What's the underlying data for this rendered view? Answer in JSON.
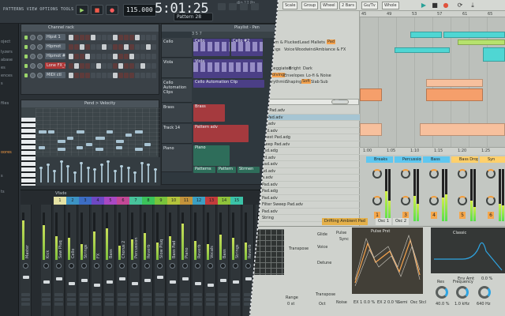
{
  "fl": {
    "title": "dio 12 Po",
    "menu": "PATTERNS VIEW OPTIONS TOOLS ?",
    "tempo": "115.000",
    "time": "5:01:25",
    "pattern": "Pattern 28",
    "channel_rack_title": "Channel rack",
    "channels": [
      {
        "name": "Hipst 1",
        "red": false
      },
      {
        "name": "Hipmot",
        "red": false
      },
      {
        "name": "Hipmot #2",
        "red": false
      },
      {
        "name": "Lone FX_sinog",
        "red": true
      },
      {
        "name": "MIDI ctl",
        "red": false
      }
    ],
    "browser_items": [
      {
        "label": "oject",
        "hi": false
      },
      {
        "label": "lyzers",
        "hi": false
      },
      {
        "label": "abase",
        "hi": false
      },
      {
        "label": "es",
        "hi": false
      },
      {
        "label": "ences",
        "hi": false
      },
      {
        "label": "s",
        "hi": false
      },
      {
        "label": "files",
        "hi": false
      },
      {
        "label": "oores",
        "hi": true
      },
      {
        "label": "s",
        "hi": false
      },
      {
        "label": "ts",
        "hi": false
      }
    ],
    "pianoroll_title": "Pend > Velocity",
    "playlist_title": "Playlist - Pen",
    "playlist_tracks": [
      "Cello",
      "Viola",
      "Cello Automation Clips",
      "Brass",
      "Track 14",
      "Piano"
    ],
    "clip_labels": {
      "cello": "Cello",
      "cello2": "Cello #2",
      "viola": "Viola",
      "automation": "Cello Automation Clip",
      "brass": "Brass",
      "pattern": "Pattern adv",
      "piano": "Piano",
      "pattern2": "Patterns",
      "pattern3": "Pattern",
      "strm": "Strmen"
    },
    "ruler_numbers": [
      "3",
      "5",
      "7"
    ],
    "mixer_strips": [
      "Master",
      "Kick",
      "Saw Pluq",
      "Cello",
      "Strings",
      "FX",
      "Bass",
      "Chorus 2",
      "Percussion",
      "Reverb",
      "Slow Pluq",
      "Bass Pad",
      "Piano",
      "Reverb",
      "Vocals",
      "Bass",
      "Strings",
      "Reverb",
      "Bass",
      "Pad"
    ],
    "mixer_colors": [
      "#e5e2a4",
      "#3c93c4",
      "#3c6dc4",
      "#6e48c3",
      "#a948c3",
      "#c34896",
      "#48c39b",
      "#3bc35a",
      "#79c33b",
      "#b4c33b",
      "#c3933b",
      "#3b9fc3",
      "#c33b3b",
      "#8fc33b",
      "#3bc3a8"
    ],
    "mixer_numbers": [
      "1",
      "2",
      "3",
      "4",
      "5",
      "6",
      "7",
      "8",
      "9",
      "10",
      "11",
      "12",
      "13",
      "14",
      "15"
    ],
    "mixer_fx_label": "Vfade"
  },
  "ab": {
    "top_fields": [
      "Scale",
      "Group",
      "Wheel",
      "2 Bars",
      "Gu/Tv",
      "Whole"
    ],
    "ruler_top": [
      "45",
      "49",
      "53",
      "57",
      "61",
      "65"
    ],
    "ruler_bottom": [
      "1:00",
      "1:05",
      "1:10",
      "1:15",
      "1:20",
      "1:25"
    ],
    "tags_row1": [
      {
        "label": "Strum & Plucked",
        "on": false
      },
      {
        "label": "Lead",
        "on": false
      },
      {
        "label": "Mallets",
        "on": false
      },
      {
        "label": "Pad",
        "on": true
      }
    ],
    "tags_row2": [
      "Strings",
      "Voice",
      "Woodwind",
      "Ambiance & FX"
    ],
    "tags_row3": [
      {
        "label": "Arpeggiated",
        "on": false
      },
      {
        "label": "Bright",
        "on": false
      },
      {
        "label": "Dark",
        "on": false
      }
    ],
    "tags_row4": [
      {
        "label": "Evolving",
        "on": true
      },
      {
        "label": "Envelopes",
        "on": false
      },
      {
        "label": "Lo-fi & Noise",
        "on": false
      }
    ],
    "tags_row5": [
      {
        "label": "Phrythmic",
        "on": false
      },
      {
        "label": "Shaping",
        "on": false
      },
      {
        "label": "Soft",
        "on": true
      },
      {
        "label": "Slab",
        "on": false
      },
      {
        "label": "Sub",
        "on": false
      }
    ],
    "extra_tag": "pad",
    "clear_label": "Clear",
    "presets": [
      {
        "name": "ipp Pad.adv",
        "sel": false
      },
      {
        "name": "nt Pad.adv",
        "sel": true
      },
      {
        "name": "ad.adv",
        "sel": false
      },
      {
        "name": "Pad.adv",
        "sel": false
      },
      {
        "name": "Chest Pad.adg",
        "sel": false
      },
      {
        "name": "Sleep Pad.adv",
        "sel": false
      },
      {
        "name": "Pad.adg",
        "sel": false
      },
      {
        "name": "ad.adv",
        "sel": false
      },
      {
        "name": "Pad.adv",
        "sel": false
      },
      {
        "name": "ad.adv",
        "sel": false
      },
      {
        "name": "a.adv",
        "sel": false
      },
      {
        "name": "Pad.adv",
        "sel": false
      },
      {
        "name": "Pad.adg",
        "sel": false
      },
      {
        "name": "Pad.adv",
        "sel": false
      },
      {
        "name": "Filter Sweep Pad.adv",
        "sel": false
      },
      {
        "name": "Pad.adv",
        "sel": false
      },
      {
        "name": "String",
        "sel": false
      }
    ],
    "channels": [
      {
        "name": "Breaks",
        "num": "1",
        "color": "#5ec7f0"
      },
      {
        "name": "Percussion",
        "num": "3",
        "color": "#5ec7f0"
      },
      {
        "name": "Bass",
        "num": "4",
        "color": "#5ec7f0"
      },
      {
        "name": "Bass Drop",
        "num": "5",
        "color": "#ffd06b"
      },
      {
        "name": "Syn",
        "num": "6",
        "color": "#ffd06b"
      }
    ],
    "device_title": "Drifting Ambient Pad",
    "device_tab": "Osc 1",
    "device_tab2": "Osc 2",
    "labels": {
      "transpose": "Transpose",
      "range": "Range",
      "range_val": "0 st",
      "glide": "Glide",
      "voice": "Voice",
      "detune": "Detune",
      "transpose2": "Transpose",
      "oct": "Oct",
      "pulse": "Pulse",
      "wave": "Pulse Prst",
      "fx1": "EX 1 0.0 %",
      "fx2": "EX 2 0.0 %",
      "semi": "Semi",
      "sub": "Osc Stcl",
      "res": "Res",
      "freq": "Frequency",
      "res_val": "40.0 %",
      "freq_val": "1.0 kHz",
      "classic": "Classic",
      "freq2_val": "640 Hz",
      "noise": "Noise",
      "env": "Env Amt",
      "env_val": "0.0 %",
      "sync": "Sync"
    }
  }
}
